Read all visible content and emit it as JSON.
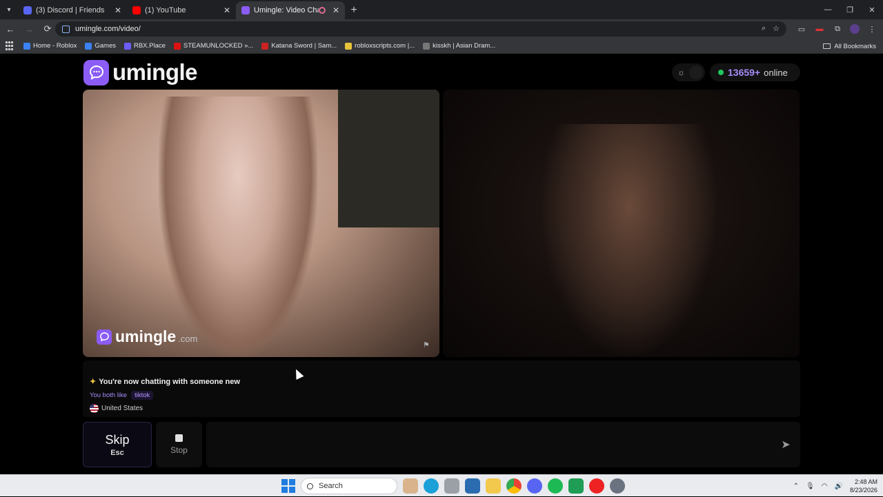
{
  "browser": {
    "tabs": [
      {
        "title": "(3) Discord | Friends",
        "favicon_color": "#5865f2",
        "active": false
      },
      {
        "title": "(1) YouTube",
        "favicon_color": "#ff0000",
        "active": false
      },
      {
        "title": "Umingle: Video Chat with S",
        "favicon_color": "#8b5cf6",
        "active": true
      }
    ],
    "tab_close": "✕",
    "new_tab": "+",
    "url": "umingle.com/video/",
    "window_controls": {
      "minimize": "—",
      "restore": "❐",
      "close": "✕"
    },
    "nav": {
      "back": "←",
      "forward": "→",
      "reload": "⟳"
    },
    "bookmarks": [
      {
        "label": "Home - Roblox",
        "color": "#3b82f6"
      },
      {
        "label": "Games",
        "color": "#3b82f6"
      },
      {
        "label": "RBX.Place",
        "color": "#6d5dfc"
      },
      {
        "label": "STEAMUNLOCKED »...",
        "color": "#d11"
      },
      {
        "label": "Katana Sword | Sam...",
        "color": "#c22"
      },
      {
        "label": "robloxscripts.com |...",
        "color": "#e8c33a"
      },
      {
        "label": "kisskh | Asian Dram...",
        "color": "#777"
      }
    ],
    "all_bookmarks": "All Bookmarks"
  },
  "site": {
    "logo_text": "umingle",
    "online_count": "13659+",
    "online_label": "online",
    "watermark_name": "umingle",
    "watermark_domain": ".com",
    "accent": "#8b5cf6"
  },
  "status": {
    "message": "You're now chatting with someone new",
    "likes_label": "You both like",
    "like_tag": "tiktok",
    "country": "United States"
  },
  "controls": {
    "skip_label": "Skip",
    "skip_hint": "Esc",
    "stop_label": "Stop",
    "message_placeholder": ""
  },
  "taskbar": {
    "search_label": "Search",
    "time": "2:48 AM",
    "date": "8/23/2026",
    "pinned": [
      {
        "name": "photos",
        "color": "#d9b38c"
      },
      {
        "name": "edge",
        "color": "#1ba0d8"
      },
      {
        "name": "mouse-app",
        "color": "#9aa0a6"
      },
      {
        "name": "store",
        "color": "#2b6cb0"
      },
      {
        "name": "file-explorer",
        "color": "#f2c94c"
      },
      {
        "name": "chrome",
        "color": "#34a853"
      },
      {
        "name": "discord",
        "color": "#5865f2"
      },
      {
        "name": "spotify",
        "color": "#1db954"
      },
      {
        "name": "app-green",
        "color": "#1f9d55"
      },
      {
        "name": "opera",
        "color": "#e22"
      },
      {
        "name": "settings",
        "color": "#6b7280"
      }
    ]
  }
}
